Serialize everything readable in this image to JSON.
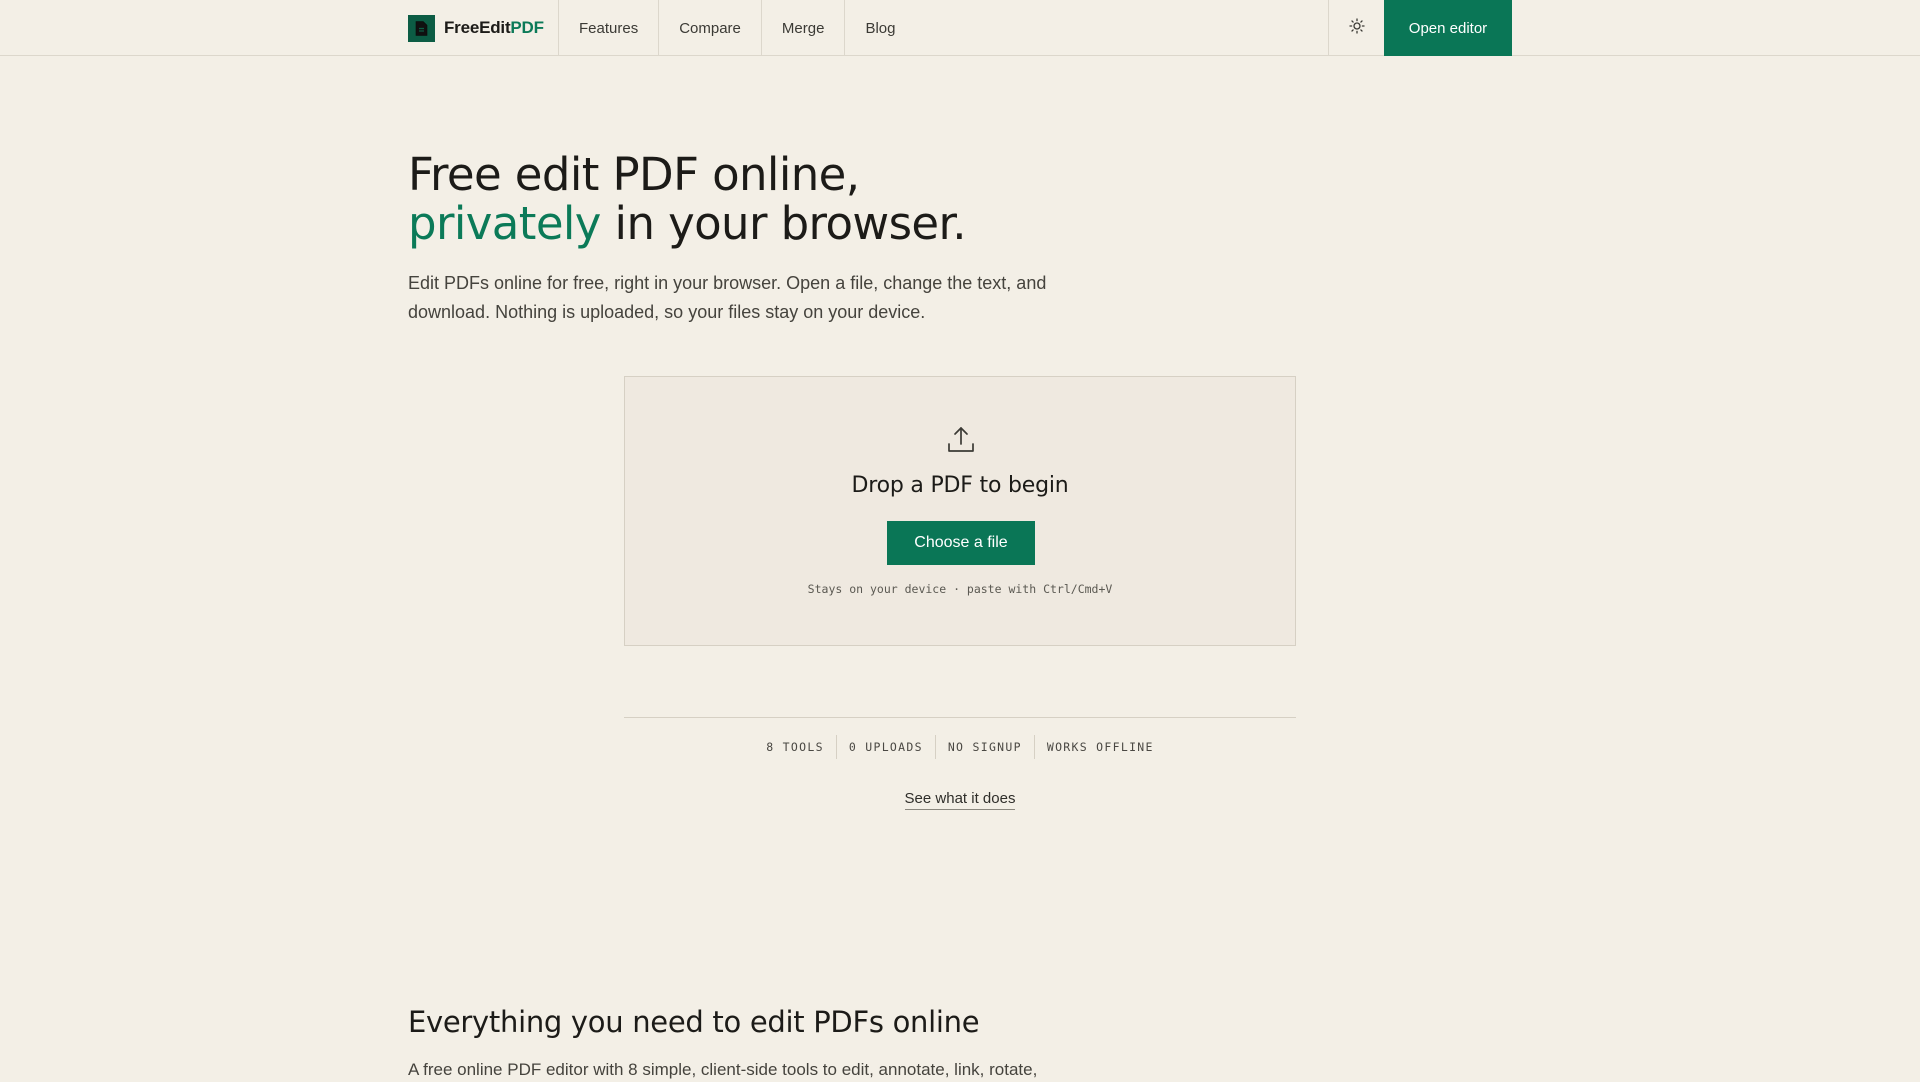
{
  "nav": {
    "logo_main": "FreeEdit",
    "logo_accent": "PDF",
    "links": [
      "Features",
      "Compare",
      "Merge",
      "Blog"
    ],
    "theme_icon": "sun-icon",
    "cta": "Open editor"
  },
  "hero": {
    "title_line1": "Free edit PDF online,",
    "title_accent": "privately",
    "title_rest": " in your browser.",
    "subtitle": "Edit PDFs online for free, right in your browser. Open a file, change the text, and download. Nothing is uploaded, so your files stay on your device."
  },
  "dropzone": {
    "icon": "upload-icon",
    "title": "Drop a PDF to begin",
    "button": "Choose a file",
    "hint": "Stays on your device · paste with Ctrl/Cmd+V"
  },
  "stats": [
    "8 TOOLS",
    "0 UPLOADS",
    "NO SIGNUP",
    "WORKS OFFLINE"
  ],
  "see_link": "See what it does",
  "section": {
    "title": "Everything you need to edit PDFs online",
    "text": "A free online PDF editor with 8 simple, client-side tools to edit, annotate, link, rotate,"
  },
  "colors": {
    "background": "#f3efe6",
    "accent": "#0a7656",
    "border": "#dcd7cc"
  }
}
